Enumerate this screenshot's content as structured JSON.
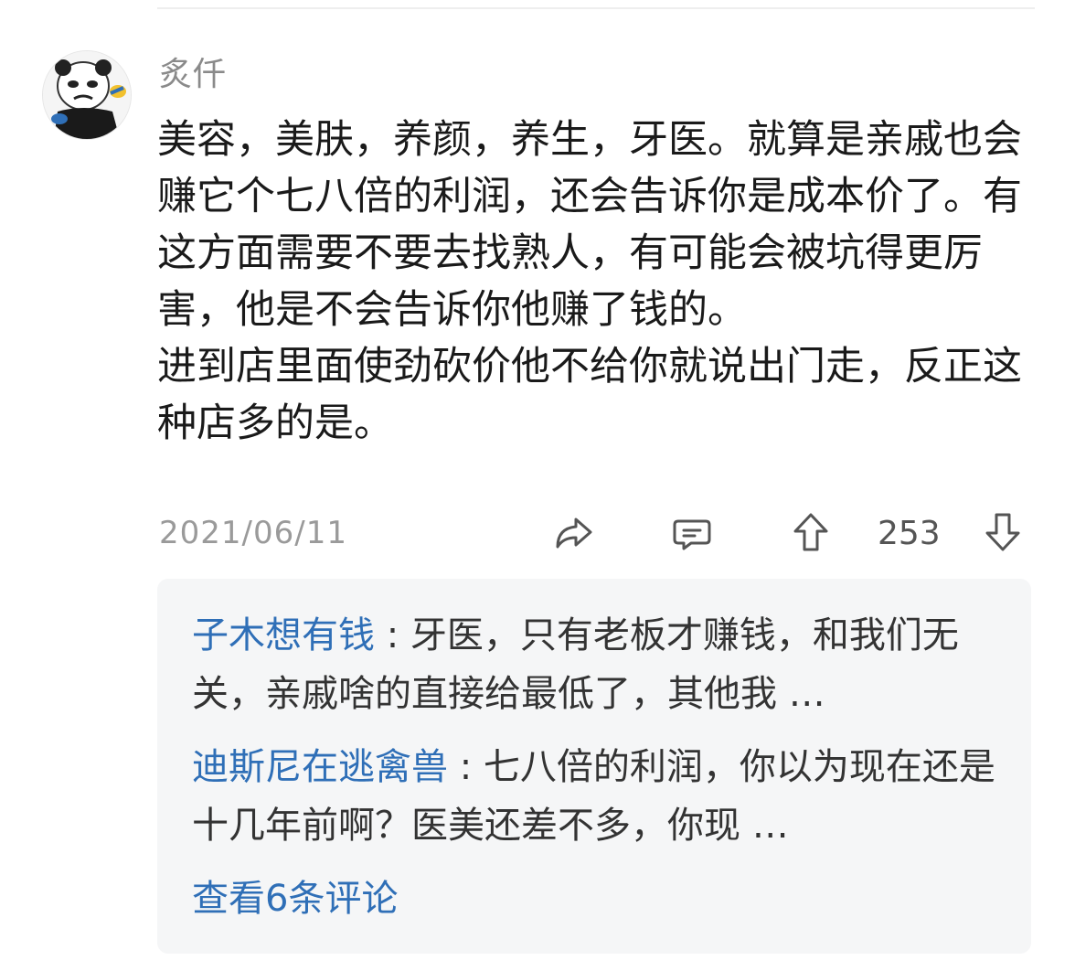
{
  "comment": {
    "username": "炙仟",
    "paragraphs": [
      "美容，美肤，养颜，养生，牙医。就算是亲戚也会赚它个七八倍的利润，还会告诉你是成本价了。有这方面需要不要去找熟人，有可能会被坑得更厉害，他是不会告诉你他赚了钱的。",
      "进到店里面使劲砍价他不给你就说出门走，反正这种店多的是。"
    ],
    "date": "2021/06/11",
    "vote_count": "253"
  },
  "replies": {
    "items": [
      {
        "author": "子木想有钱",
        "separator": " : ",
        "text": "牙医，只有老板才赚钱，和我们无关，亲戚啥的直接给最低了，其他我 …"
      },
      {
        "author": "迪斯尼在逃禽兽",
        "separator": " : ",
        "text": "七八倍的利润，你以为现在还是十几年前啊？医美还差不多，你现 …"
      }
    ],
    "view_more": "查看6条评论"
  },
  "colors": {
    "link": "#2f6fb7",
    "muted": "#9a9a9a",
    "reply_bg": "#f5f6f7"
  },
  "icons": [
    "share-icon",
    "reply-icon",
    "upvote-icon",
    "downvote-icon"
  ]
}
